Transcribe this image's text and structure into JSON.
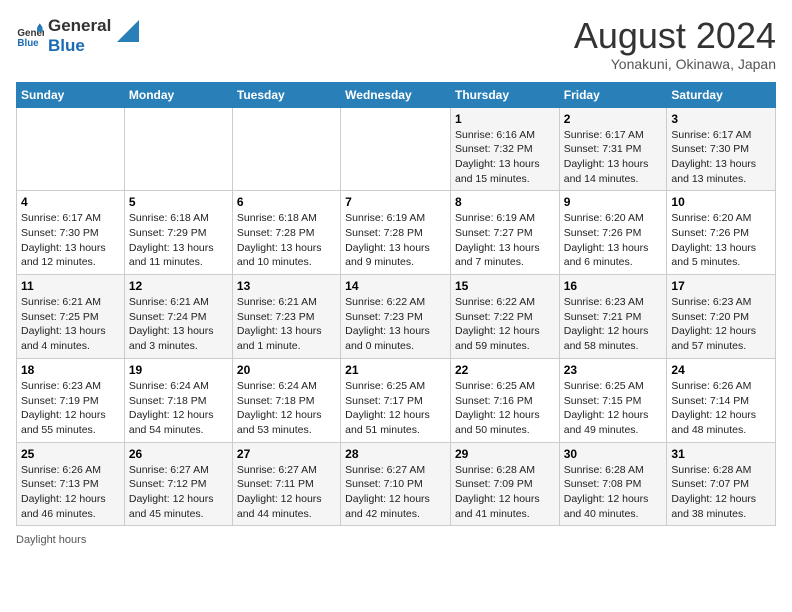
{
  "header": {
    "logo_line1": "General",
    "logo_line2": "Blue",
    "main_title": "August 2024",
    "subtitle": "Yonakuni, Okinawa, Japan"
  },
  "days_of_week": [
    "Sunday",
    "Monday",
    "Tuesday",
    "Wednesday",
    "Thursday",
    "Friday",
    "Saturday"
  ],
  "weeks": [
    [
      {
        "day": "",
        "info": ""
      },
      {
        "day": "",
        "info": ""
      },
      {
        "day": "",
        "info": ""
      },
      {
        "day": "",
        "info": ""
      },
      {
        "day": "1",
        "info": "Sunrise: 6:16 AM\nSunset: 7:32 PM\nDaylight: 13 hours and 15 minutes."
      },
      {
        "day": "2",
        "info": "Sunrise: 6:17 AM\nSunset: 7:31 PM\nDaylight: 13 hours and 14 minutes."
      },
      {
        "day": "3",
        "info": "Sunrise: 6:17 AM\nSunset: 7:30 PM\nDaylight: 13 hours and 13 minutes."
      }
    ],
    [
      {
        "day": "4",
        "info": "Sunrise: 6:17 AM\nSunset: 7:30 PM\nDaylight: 13 hours and 12 minutes."
      },
      {
        "day": "5",
        "info": "Sunrise: 6:18 AM\nSunset: 7:29 PM\nDaylight: 13 hours and 11 minutes."
      },
      {
        "day": "6",
        "info": "Sunrise: 6:18 AM\nSunset: 7:28 PM\nDaylight: 13 hours and 10 minutes."
      },
      {
        "day": "7",
        "info": "Sunrise: 6:19 AM\nSunset: 7:28 PM\nDaylight: 13 hours and 9 minutes."
      },
      {
        "day": "8",
        "info": "Sunrise: 6:19 AM\nSunset: 7:27 PM\nDaylight: 13 hours and 7 minutes."
      },
      {
        "day": "9",
        "info": "Sunrise: 6:20 AM\nSunset: 7:26 PM\nDaylight: 13 hours and 6 minutes."
      },
      {
        "day": "10",
        "info": "Sunrise: 6:20 AM\nSunset: 7:26 PM\nDaylight: 13 hours and 5 minutes."
      }
    ],
    [
      {
        "day": "11",
        "info": "Sunrise: 6:21 AM\nSunset: 7:25 PM\nDaylight: 13 hours and 4 minutes."
      },
      {
        "day": "12",
        "info": "Sunrise: 6:21 AM\nSunset: 7:24 PM\nDaylight: 13 hours and 3 minutes."
      },
      {
        "day": "13",
        "info": "Sunrise: 6:21 AM\nSunset: 7:23 PM\nDaylight: 13 hours and 1 minute."
      },
      {
        "day": "14",
        "info": "Sunrise: 6:22 AM\nSunset: 7:23 PM\nDaylight: 13 hours and 0 minutes."
      },
      {
        "day": "15",
        "info": "Sunrise: 6:22 AM\nSunset: 7:22 PM\nDaylight: 12 hours and 59 minutes."
      },
      {
        "day": "16",
        "info": "Sunrise: 6:23 AM\nSunset: 7:21 PM\nDaylight: 12 hours and 58 minutes."
      },
      {
        "day": "17",
        "info": "Sunrise: 6:23 AM\nSunset: 7:20 PM\nDaylight: 12 hours and 57 minutes."
      }
    ],
    [
      {
        "day": "18",
        "info": "Sunrise: 6:23 AM\nSunset: 7:19 PM\nDaylight: 12 hours and 55 minutes."
      },
      {
        "day": "19",
        "info": "Sunrise: 6:24 AM\nSunset: 7:18 PM\nDaylight: 12 hours and 54 minutes."
      },
      {
        "day": "20",
        "info": "Sunrise: 6:24 AM\nSunset: 7:18 PM\nDaylight: 12 hours and 53 minutes."
      },
      {
        "day": "21",
        "info": "Sunrise: 6:25 AM\nSunset: 7:17 PM\nDaylight: 12 hours and 51 minutes."
      },
      {
        "day": "22",
        "info": "Sunrise: 6:25 AM\nSunset: 7:16 PM\nDaylight: 12 hours and 50 minutes."
      },
      {
        "day": "23",
        "info": "Sunrise: 6:25 AM\nSunset: 7:15 PM\nDaylight: 12 hours and 49 minutes."
      },
      {
        "day": "24",
        "info": "Sunrise: 6:26 AM\nSunset: 7:14 PM\nDaylight: 12 hours and 48 minutes."
      }
    ],
    [
      {
        "day": "25",
        "info": "Sunrise: 6:26 AM\nSunset: 7:13 PM\nDaylight: 12 hours and 46 minutes."
      },
      {
        "day": "26",
        "info": "Sunrise: 6:27 AM\nSunset: 7:12 PM\nDaylight: 12 hours and 45 minutes."
      },
      {
        "day": "27",
        "info": "Sunrise: 6:27 AM\nSunset: 7:11 PM\nDaylight: 12 hours and 44 minutes."
      },
      {
        "day": "28",
        "info": "Sunrise: 6:27 AM\nSunset: 7:10 PM\nDaylight: 12 hours and 42 minutes."
      },
      {
        "day": "29",
        "info": "Sunrise: 6:28 AM\nSunset: 7:09 PM\nDaylight: 12 hours and 41 minutes."
      },
      {
        "day": "30",
        "info": "Sunrise: 6:28 AM\nSunset: 7:08 PM\nDaylight: 12 hours and 40 minutes."
      },
      {
        "day": "31",
        "info": "Sunrise: 6:28 AM\nSunset: 7:07 PM\nDaylight: 12 hours and 38 minutes."
      }
    ]
  ],
  "footer": {
    "daylight_label": "Daylight hours"
  }
}
